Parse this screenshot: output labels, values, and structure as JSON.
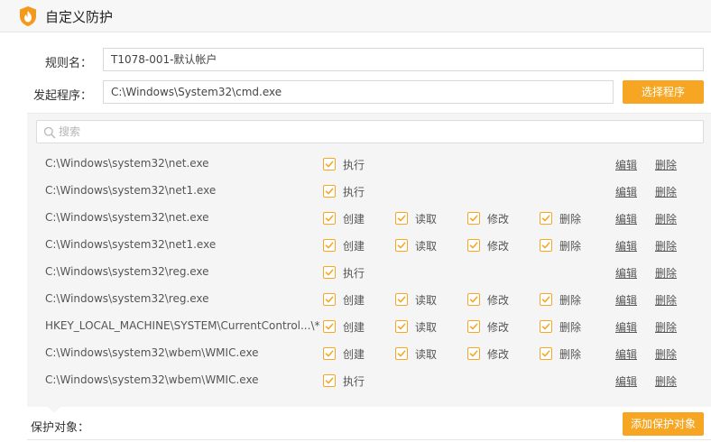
{
  "window": {
    "title": "自定义防护",
    "logo_icon": "flame-shield-icon"
  },
  "form": {
    "rule_name_label": "规则名：",
    "rule_name_value": "T1078-001-默认帐户",
    "initiator_label": "发起程序：",
    "initiator_value": "C:\\Windows\\System32\\cmd.exe",
    "select_program_button": "选择程序"
  },
  "search": {
    "placeholder": "搜索",
    "icon": "search-icon"
  },
  "actions": {
    "edit": "编辑",
    "delete": "删除"
  },
  "rules": [
    {
      "path": "C:\\Windows\\system32\\net.exe",
      "perms": [
        "执行"
      ]
    },
    {
      "path": "C:\\Windows\\system32\\net1.exe",
      "perms": [
        "执行"
      ]
    },
    {
      "path": "C:\\Windows\\system32\\net.exe",
      "perms": [
        "创建",
        "读取",
        "修改",
        "删除"
      ]
    },
    {
      "path": "C:\\Windows\\system32\\net1.exe",
      "perms": [
        "创建",
        "读取",
        "修改",
        "删除"
      ]
    },
    {
      "path": "C:\\Windows\\system32\\reg.exe",
      "perms": [
        "执行"
      ]
    },
    {
      "path": "C:\\Windows\\system32\\reg.exe",
      "perms": [
        "创建",
        "读取",
        "修改",
        "删除"
      ]
    },
    {
      "path": "HKEY_LOCAL_MACHINE\\SYSTEM\\CurrentControl...\\*",
      "perms": [
        "创建",
        "读取",
        "修改",
        "删除"
      ]
    },
    {
      "path": "C:\\Windows\\system32\\wbem\\WMIC.exe",
      "perms": [
        "创建",
        "读取",
        "修改",
        "删除"
      ]
    },
    {
      "path": "C:\\Windows\\system32\\wbem\\WMIC.exe",
      "perms": [
        "执行"
      ]
    }
  ],
  "footer": {
    "protect_label": "保护对象：",
    "add_button": "添加保护对象"
  },
  "colors": {
    "accent": "#f6a623",
    "panel_bg": "#f5f5f5",
    "titlebar_bg": "#f7f7f7"
  }
}
